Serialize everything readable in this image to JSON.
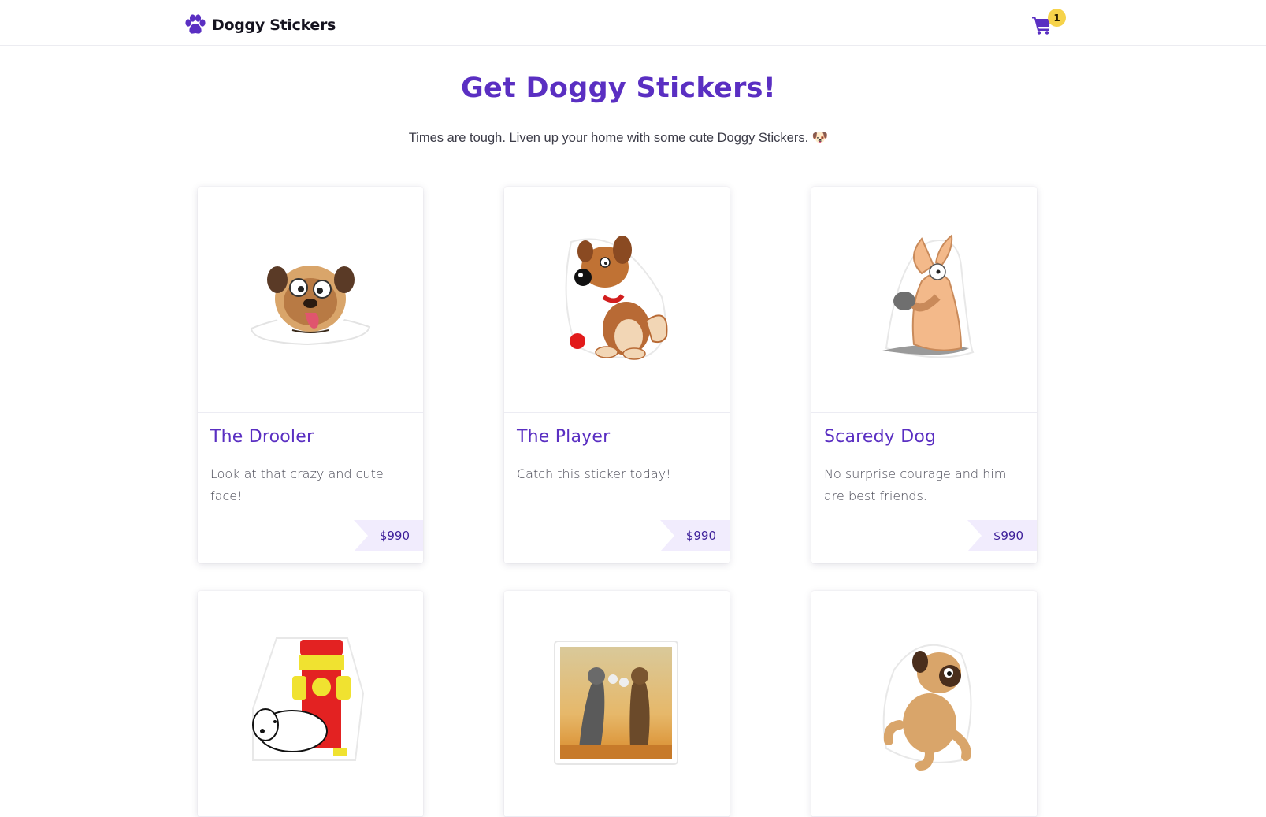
{
  "nav": {
    "brand_name": "Doggy Stickers",
    "cart_count": "1"
  },
  "hero": {
    "title": "Get Doggy Stickers!",
    "subtitle": "Times are tough. Liven up your home with some cute Doggy Stickers. 🐶"
  },
  "colors": {
    "accent": "#5a2fc2",
    "badge": "#f6d34a",
    "price_bg": "#f1ecfd"
  },
  "products": [
    {
      "title": "The Drooler",
      "description": "Look at that crazy and cute face!",
      "price": "$990",
      "image_icon": "pug-drooling-sticker"
    },
    {
      "title": "The Player",
      "description": "Catch this sticker today!",
      "price": "$990",
      "image_icon": "puppy-with-ball-sticker"
    },
    {
      "title": "Scaredy Dog",
      "description": "No surprise courage and him are best friends.",
      "price": "$990",
      "image_icon": "scared-dog-sticker"
    },
    {
      "title": "",
      "description": "",
      "price": "",
      "image_icon": "dog-fire-hydrant-sticker"
    },
    {
      "title": "",
      "description": "",
      "price": "",
      "image_icon": "boxing-dogs-sticker"
    },
    {
      "title": "",
      "description": "",
      "price": "",
      "image_icon": "dancing-pug-sticker"
    }
  ]
}
